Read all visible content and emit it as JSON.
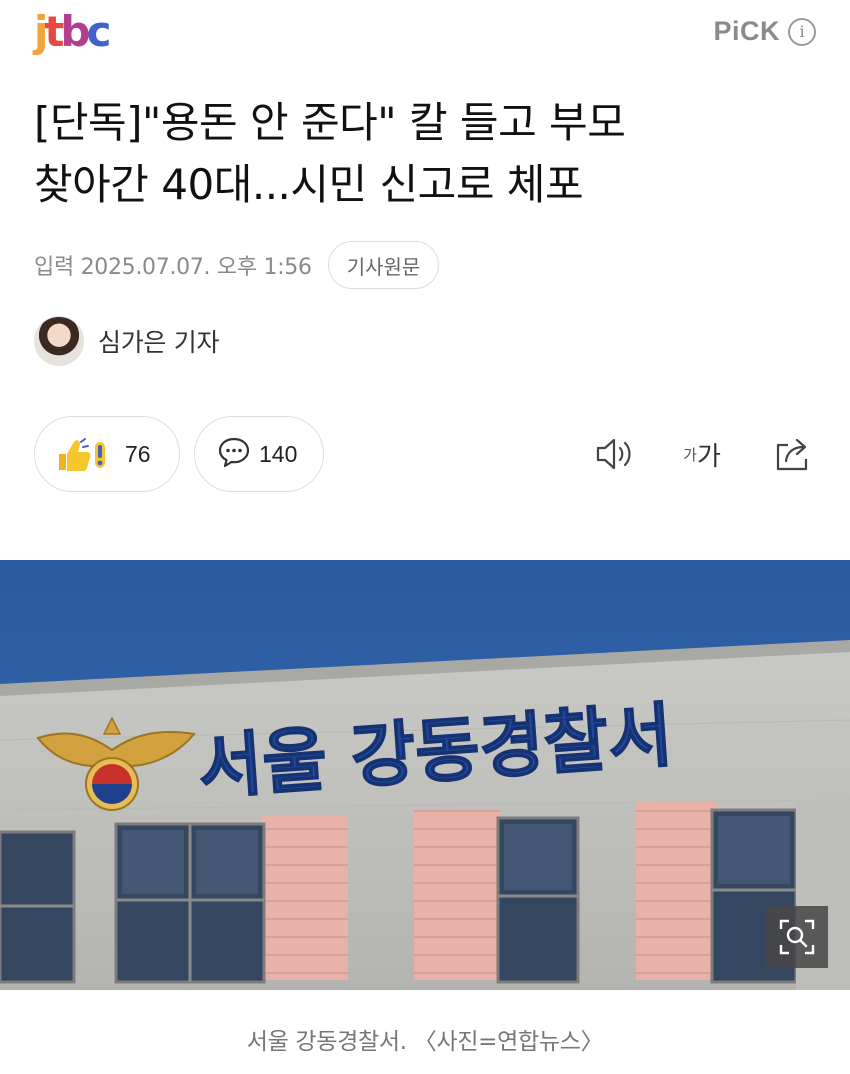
{
  "header": {
    "logo": {
      "c1": "j",
      "c2": "t",
      "c3": "b",
      "c4": "c"
    },
    "pick_label": "PiCK",
    "info_glyph": "i"
  },
  "article": {
    "headline_line1": "[단독]\"용돈 안 준다\" 칼 들고 부모",
    "headline_line2": "찾아간 40대...시민 신고로 체포",
    "date": "입력 2025.07.07. 오후 1:56",
    "original_label": "기사원문",
    "reporter_name": "심가은 기자"
  },
  "actions": {
    "reaction_count": "76",
    "comment_count": "140",
    "font_small": "가",
    "font_big": "가"
  },
  "photo": {
    "sign_text": "서울 강동경찰서",
    "caption": "서울 강동경찰서. 〈사진=연합뉴스〉"
  },
  "icons": {
    "reaction": "thumbs-up-and-exclaim-icon",
    "comment": "speech-bubble-icon",
    "speak": "speaker-icon",
    "font": "font-size-icon",
    "share": "share-icon",
    "zoom": "zoom-icon",
    "info": "info-icon"
  },
  "colors": {
    "logo_j": "#f2a33a",
    "logo_t": "#e5493f",
    "logo_b": "#b33e8f",
    "logo_c": "#3f63c8",
    "sky": "#2e5d9e",
    "sign_blue": "#23479a"
  }
}
